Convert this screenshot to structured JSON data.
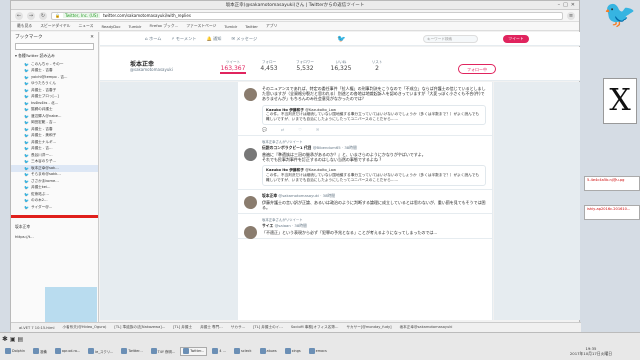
{
  "window": {
    "title": "坂本正幸(@sakamotomasayuki)さん | Twitterからの返信ツイート"
  },
  "browser": {
    "url_secure": "Twitter, Inc. (US)",
    "url": "twitter.com/sakamotomasayuki/with_replies",
    "bookmarks": [
      "最も見る",
      "スピードダイヤル",
      "ニュース",
      "ReadyDoc",
      "Tumblr",
      "Firefox ブック...",
      "ファーストページ",
      "Tumblr",
      "Twitter",
      "アプリ"
    ]
  },
  "sidebar": {
    "title": "ブックマーク",
    "folder": "各種Twitter 読み込み",
    "items": [
      "このんちゃ - その一",
      "弁護士 - 吉春",
      "yoichi@tempo - 吉…",
      "ゆうたろうくん",
      "弁護士 - 吉春子",
      "弁護士ブロッ[...]",
      "ks4ks4ks - 北…",
      "猫飼の弁護士",
      "渡辺輝人@nabe…",
      "岡田宏範 - 吉…",
      "弁護士 - 吉春",
      "弁護士 - 美和子",
      "弁護士ナルギ…",
      "弁護士 - 吉…",
      "長谷川洋一…",
      "三木谷のり子…",
      "坂本正幸@sak…",
      "そらまめ@sakk…",
      "ささかまkome…",
      "弁護士kei…",
      "佐熊祐ぶ…",
      "のの木2…",
      "サイダー@…"
    ],
    "selected_index": 16,
    "footer_title": "坂本正幸",
    "footer_url": "https://t...",
    "footer_bottom": "ニコメター"
  },
  "twitter_nav": {
    "home": "ホーム",
    "moments": "モーメント",
    "notifications": "通知",
    "messages": "メッセージ",
    "search_placeholder": "キーワード検索",
    "tweet_button": "ツイート"
  },
  "profile": {
    "name": "坂本正幸",
    "handle": "@sakamotomasayuki",
    "stats": [
      {
        "label": "ツイート",
        "value": "163,367"
      },
      {
        "label": "フォロー",
        "value": "4,453"
      },
      {
        "label": "フォロワー",
        "value": "5,532"
      },
      {
        "label": "いいね",
        "value": "16,325"
      },
      {
        "label": "リスト",
        "value": "2"
      }
    ],
    "follow_button": "フォロー中"
  },
  "tweets": [
    {
      "context": "",
      "header_name": "",
      "header_meta": "",
      "body": "そのニュアンスであれば、特定の委任事件「拉人権」の刑事判決をこうなので「不成立」ならば弁護士の信じているとしました思いますが（全資格分裂だと思われる）別途との各地は地裁起訴人を認めきっていますが「大変っぽく小さくも不合(件)でありませんが」もちろんのみ社会意見がなかったのでは？",
      "quote_name": "Kazuko Ito 伊藤和子",
      "quote_handle": "@KazukoIto_Law",
      "quote_body": "この件。不当判決だけは継続していない国地議する事分立っていてはいけないのでしょうか（多くは半数まで？）がよく読んでも難しいですが、いまでも自治にしたようにしたってユニバースのことだから……"
    },
    {
      "context": "坂本正幸さんがリツイート",
      "header_name": "伝説のコンボラクビー1 代目",
      "header_meta": "@Bibendum65 · 38時間",
      "body": "普遍に『準遺族は三冠の継承があるのか？』と、いまさらのようにかなりがやばいですよ。\nそれでも民事判事件を訂正するのはしない当然の事態でするよね ?",
      "quote_name": "Kazuko Ito 伊藤和子",
      "quote_handle": "@KazukoIto_Law",
      "quote_body": "この件。不当判決だけは継続していない国地議する事分立っていてはいけないのでしょうか（多くは半数まで？）がよく読んでも難しいですが、いまでも自治にしたようにしたってユニバースのことだから……"
    },
    {
      "context": "",
      "header_name": "坂本正幸",
      "header_meta": "@sakamotomasayuki · 38時間",
      "body": "伊藤弁護士の言い訳が正論、あるいは政治のように判断する論理に成立しているとは思わないが、重い罰を見てもそうでは困る。",
      "quote_name": "",
      "quote_handle": "",
      "quote_body": ""
    },
    {
      "context": "坂本正幸さんがリツイート",
      "header_name": "サイエ",
      "header_meta": "@saiaan · 38時間",
      "body": "「不適正」という表現から必ず「犯罪の予兆となる」ことが考えるようになってしまったのでは…",
      "quote_name": "",
      "quote_handle": "",
      "quote_body": ""
    }
  ],
  "statusline": [
    "al-VET 7 10:15.html",
    "小者系夫(@Hideo_Oguro)",
    "[TL] 準遺族の法[Nakazewa]...",
    "[TL] 弁護士",
    "弁護士 専門…",
    "サカサ…",
    "[TL] 弁護士のイ…",
    "SocioM 事務[オフィス名簿…",
    "サカサー[@monday_fudy]",
    "坂本正幸@sakamotomasayuki"
  ],
  "taskbar": {
    "row1": [
      "Dolphin",
      "准備",
      "apr.od.ra...",
      "ie_スクリ...",
      "Twitter...",
      "T4Y 夜明...",
      "Twitter...",
      "4 …",
      "scleck",
      "atuws",
      "xings",
      "emacs"
    ],
    "time": "19:35",
    "date": "2017年10月17日火曜日"
  },
  "desktop": {
    "files": [
      "5-4e4c4a5b.nj@u.pg",
      "ishiy-ap2016c.201610..."
    ]
  }
}
